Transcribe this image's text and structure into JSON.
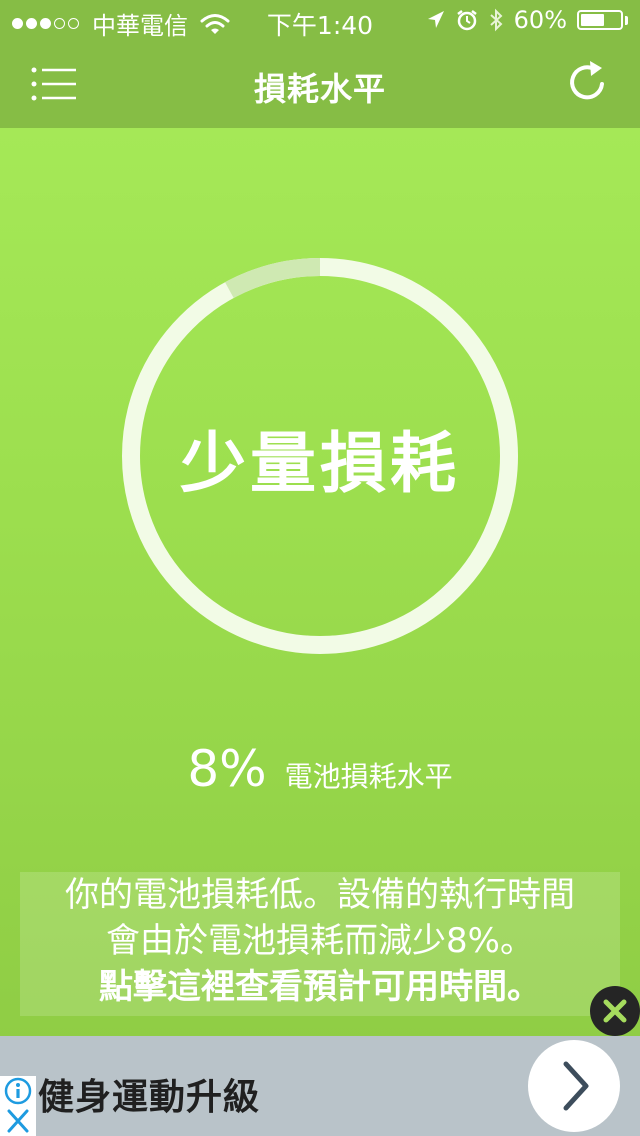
{
  "status_bar": {
    "carrier": "中華電信",
    "time": "下午1:40",
    "battery_percent_text": "60%",
    "battery_level": 0.6,
    "signal_bars_filled": 3,
    "signal_bars_total": 5,
    "icons": [
      "wifi-icon",
      "location-arrow-icon",
      "alarm-clock-icon",
      "bluetooth-icon",
      "battery-icon"
    ]
  },
  "nav": {
    "title": "損耗水平",
    "left_icon": "menu-list-icon",
    "right_icon": "refresh-icon"
  },
  "gauge": {
    "label": "少量損耗",
    "wear_fraction": 0.08,
    "ring_color": "#f2fbe6",
    "wear_segment_color": "#cfe9b2"
  },
  "wear": {
    "value": "8%",
    "caption": "電池損耗水平"
  },
  "message": {
    "line1": "你的電池損耗低。設備的執行時間",
    "line2": "會由於電池損耗而減少8%。",
    "line3": "點擊這裡查看預計可用時間。"
  },
  "ad": {
    "title": "健身運動升級",
    "info_icon": "info-icon",
    "close_icon": "close-x-icon",
    "cta_icon": "chevron-right-icon"
  },
  "colors": {
    "bar_green": "#86bd45",
    "background_top": "#a8ec5a",
    "background_bottom": "#8dca43",
    "ad_background": "#b9c3c9"
  }
}
